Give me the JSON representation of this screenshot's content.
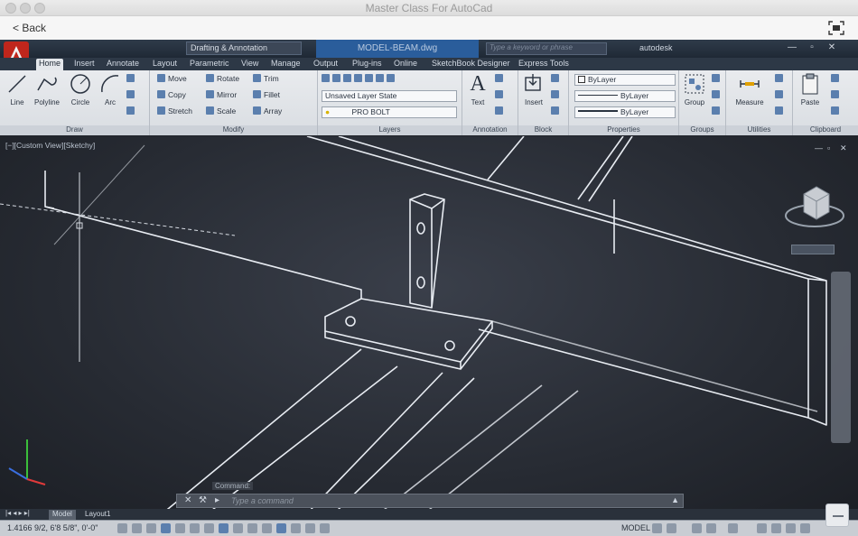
{
  "window": {
    "title": "Master Class For AutoCad"
  },
  "nav": {
    "back_label": "< Back",
    "expand_icon": "fullscreen-icon"
  },
  "acad": {
    "workspace": "Drafting & Annotation",
    "file_title": "MODEL-BEAM.dwg",
    "search_placeholder": "Type a keyword or phrase",
    "user": "autodesk",
    "tabs": [
      "Home",
      "Insert",
      "Annotate",
      "Layout",
      "Parametric",
      "View",
      "Manage",
      "Output",
      "Plug-ins",
      "Online",
      "SketchBook Designer",
      "Express Tools"
    ],
    "active_tab": "Home",
    "draw": {
      "title": "Draw",
      "buttons": [
        "Line",
        "Polyline",
        "Circle",
        "Arc"
      ]
    },
    "modify": {
      "title": "Modify",
      "buttons": [
        "Move",
        "Rotate",
        "Trim",
        "Copy",
        "Mirror",
        "Fillet",
        "Stretch",
        "Scale",
        "Array"
      ]
    },
    "layers": {
      "title": "Layers",
      "layer_state": "Unsaved Layer State",
      "current_layer": "PRO BOLT"
    },
    "annotation": {
      "title": "Annotation",
      "text_label": "Text"
    },
    "block": {
      "title": "Block",
      "insert_label": "Insert"
    },
    "properties": {
      "title": "Properties",
      "color": "ByLayer",
      "linetype": "ByLayer",
      "lineweight": "ByLayer"
    },
    "groups": {
      "title": "Groups",
      "group_label": "Group"
    },
    "utilities": {
      "title": "Utilities",
      "measure_label": "Measure"
    },
    "clipboard": {
      "title": "Clipboard",
      "paste_label": "Paste"
    },
    "viewport_label": "[−][Custom View][Sketchy]",
    "command_history": "Command:",
    "command_placeholder": "Type a command",
    "layout_tabs": [
      "Model",
      "Layout1"
    ],
    "coords": "1.4166 9/2, 6'8 5/8\", 0'-0\"",
    "model_label": "MODEL"
  },
  "colors": {
    "accent": "#2a5d9b",
    "viewport_bg": "#272b33",
    "logo_red": "#c0261c"
  }
}
